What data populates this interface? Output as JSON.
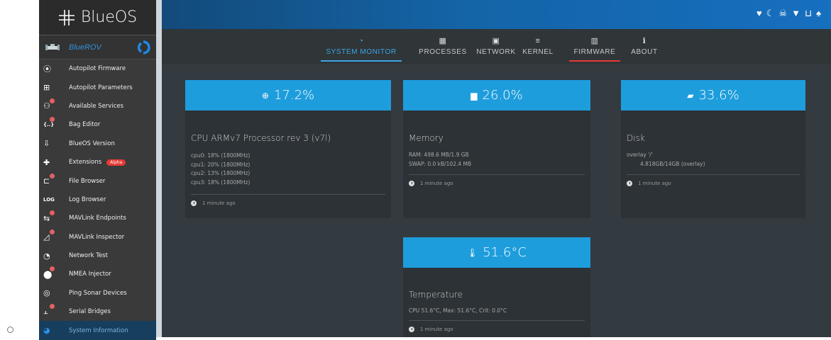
{
  "app": {
    "name": "BlueOS"
  },
  "vehicle": {
    "name": "BlueROV"
  },
  "sidebar": {
    "items": [
      {
        "label": "Autopilot Firmware",
        "icon": "chip-icon",
        "glyph": "⦿",
        "badge": false,
        "active": false
      },
      {
        "label": "Autopilot Parameters",
        "icon": "table-icon",
        "glyph": "⊞",
        "badge": false,
        "active": false
      },
      {
        "label": "Available Services",
        "icon": "services-icon",
        "glyph": "⚇",
        "badge": true,
        "active": false
      },
      {
        "label": "Bag Editor",
        "icon": "braces-icon",
        "glyph": "{..}",
        "badge": true,
        "active": false
      },
      {
        "label": "BlueOS Version",
        "icon": "download-box-icon",
        "glyph": "⇩",
        "badge": false,
        "active": false
      },
      {
        "label": "Extensions",
        "icon": "puzzle-icon",
        "glyph": "✚",
        "badge": false,
        "active": false,
        "pill": "Alpha"
      },
      {
        "label": "File Browser",
        "icon": "file-tree-icon",
        "glyph": "⊏",
        "badge": true,
        "active": false
      },
      {
        "label": "Log Browser",
        "icon": "log-icon",
        "glyph": "LOG",
        "badge": false,
        "active": false
      },
      {
        "label": "MAVLink Endpoints",
        "icon": "endpoints-icon",
        "glyph": "⇆",
        "badge": true,
        "active": false
      },
      {
        "label": "MAVLink Inspector",
        "icon": "chart-area-icon",
        "glyph": "◿",
        "badge": true,
        "active": false
      },
      {
        "label": "Network Test",
        "icon": "speedometer-icon",
        "glyph": "◔",
        "badge": false,
        "active": false
      },
      {
        "label": "NMEA Injector",
        "icon": "map-marker-icon",
        "glyph": "⬤",
        "badge": true,
        "active": false
      },
      {
        "label": "Ping Sonar Devices",
        "icon": "sonar-icon",
        "glyph": "◎",
        "badge": false,
        "active": false
      },
      {
        "label": "Serial Bridges",
        "icon": "serial-icon",
        "glyph": "⫠",
        "badge": true,
        "active": false
      },
      {
        "label": "System Information",
        "icon": "pie-chart-icon",
        "glyph": "◕",
        "badge": false,
        "active": true
      }
    ]
  },
  "topbar": {
    "status_icons": [
      {
        "name": "heartbeat-icon",
        "glyph": "♥"
      },
      {
        "name": "sleep-icon",
        "glyph": "☾"
      },
      {
        "name": "pirate-icon",
        "glyph": "☠"
      },
      {
        "name": "wifi-icon",
        "glyph": "▼"
      },
      {
        "name": "ethernet-icon",
        "glyph": "⊔"
      },
      {
        "name": "bell-icon",
        "glyph": "♠"
      }
    ]
  },
  "tabs": [
    {
      "label": "SYSTEM MONITOR",
      "icon": "gauge-icon",
      "glyph": "◔",
      "active": true
    },
    {
      "label": "PROCESSES",
      "icon": "processes-icon",
      "glyph": "▦",
      "active": false
    },
    {
      "label": "NETWORK",
      "icon": "network-icon",
      "glyph": "▣",
      "active": false
    },
    {
      "label": "KERNEL",
      "icon": "kernel-icon",
      "glyph": "≡",
      "active": false
    },
    {
      "label": "FIRMWARE",
      "icon": "firmware-icon",
      "glyph": "▥",
      "active": false
    },
    {
      "label": "ABOUT",
      "icon": "info-icon",
      "glyph": "ℹ",
      "active": false
    }
  ],
  "accent": {
    "active_tab": "#3ba6e6",
    "firmware_underline": "#e53935",
    "card_header": "#1e9ddc"
  },
  "cards": {
    "cpu": {
      "value": "17.2%",
      "title": "CPU ARMv7 Processor rev 3 (v7l)",
      "lines": [
        "cpu0: 18% (1800MHz)",
        "cpu1: 20% (1800MHz)",
        "cpu2: 13% (1800MHz)",
        "cpu3: 18% (1800MHz)"
      ],
      "updated": "1 minute ago"
    },
    "memory": {
      "value": "26.0%",
      "title": "Memory",
      "lines": [
        "RAM: 498.6 MB/1.9 GB",
        "SWAP: 0.0 kB/102.4 MB"
      ],
      "updated": "1 minute ago"
    },
    "disk": {
      "value": "33.6%",
      "title": "Disk",
      "lines": [
        "overlay '/'",
        "4.818GB/14GB (overlay)"
      ],
      "updated": "1 minute ago"
    },
    "temperature": {
      "value": "51.6°C",
      "title": "Temperature",
      "lines": [
        "CPU 51.6°C, Max: 51.6°C, Crit: 0.0°C"
      ],
      "updated": "1 minute ago"
    }
  }
}
